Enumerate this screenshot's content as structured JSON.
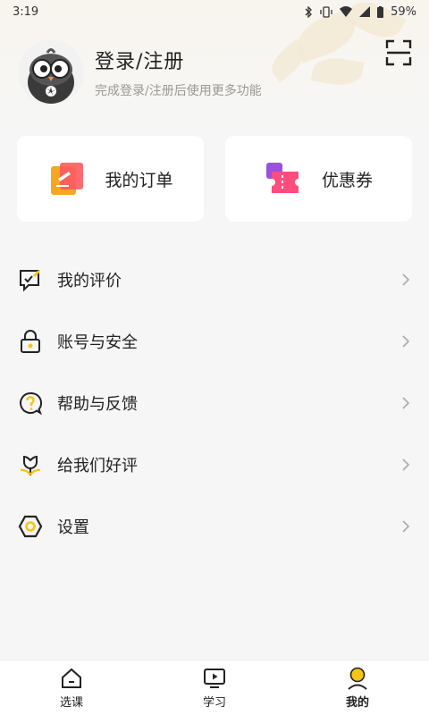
{
  "status_bar": {
    "time": "3:19",
    "battery": "59%"
  },
  "profile": {
    "title": "登录/注册",
    "subtitle": "完成登录/注册后使用更多功能"
  },
  "quick_cards": [
    {
      "label": "我的订单",
      "icon": "order-icon"
    },
    {
      "label": "优惠券",
      "icon": "coupon-icon"
    }
  ],
  "menu": [
    {
      "label": "我的评价",
      "icon": "review-icon"
    },
    {
      "label": "账号与安全",
      "icon": "lock-icon"
    },
    {
      "label": "帮助与反馈",
      "icon": "help-icon"
    },
    {
      "label": "给我们好评",
      "icon": "flower-icon"
    },
    {
      "label": "设置",
      "icon": "settings-icon"
    }
  ],
  "bottom_nav": [
    {
      "label": "选课",
      "icon": "home-icon",
      "active": false
    },
    {
      "label": "学习",
      "icon": "play-icon",
      "active": false
    },
    {
      "label": "我的",
      "icon": "user-icon",
      "active": true
    }
  ],
  "colors": {
    "accent": "#f5c518",
    "background": "#f6f6f6",
    "card": "#ffffff"
  }
}
